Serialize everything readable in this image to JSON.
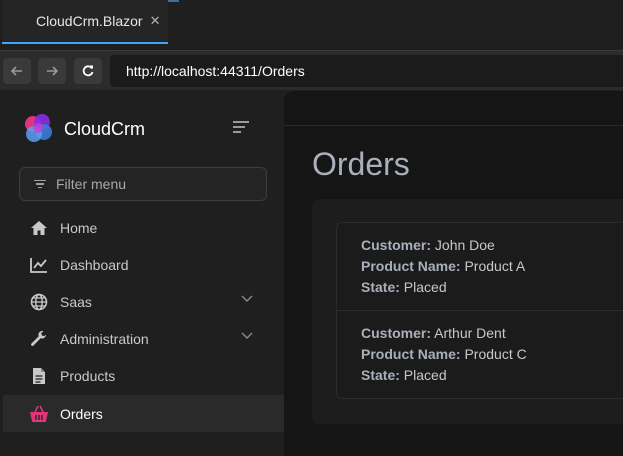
{
  "browser": {
    "tab_title": "CloudCrm.Blazor",
    "tab_close": "✕",
    "url": "http://localhost:44311/Orders"
  },
  "sidebar": {
    "brand": "CloudCrm",
    "filter_placeholder": "Filter menu",
    "items": [
      {
        "label": "Home",
        "icon": "home-icon"
      },
      {
        "label": "Dashboard",
        "icon": "chart-line-icon"
      },
      {
        "label": "Saas",
        "icon": "globe-icon",
        "expandable": true
      },
      {
        "label": "Administration",
        "icon": "wrench-icon",
        "expandable": true
      },
      {
        "label": "Products",
        "icon": "file-icon"
      },
      {
        "label": "Orders",
        "icon": "basket-icon",
        "active": true
      }
    ]
  },
  "main": {
    "title": "Orders",
    "orders": [
      {
        "customer_label": "Customer:",
        "customer": "John Doe",
        "product_label": "Product Name:",
        "product": "Product A",
        "state_label": "State:",
        "state": "Placed"
      },
      {
        "customer_label": "Customer:",
        "customer": "Arthur Dent",
        "product_label": "Product Name:",
        "product": "Product C",
        "state_label": "State:",
        "state": "Placed"
      }
    ]
  },
  "colors": {
    "accent_tab": "#3fa6ff",
    "active_icon": "#e0357a"
  }
}
